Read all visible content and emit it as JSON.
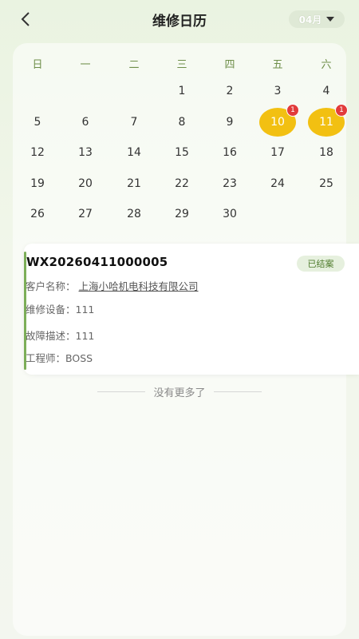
{
  "header": {
    "title": "维修日历",
    "back_icon": "chevron-left-icon",
    "month": "04月",
    "month_caret_icon": "caret-down-icon"
  },
  "calendar": {
    "weekdays": [
      "日",
      "一",
      "二",
      "三",
      "四",
      "五",
      "六"
    ],
    "days": [
      {
        "d": "1"
      },
      {
        "d": "2"
      },
      {
        "d": "3"
      },
      {
        "d": "4"
      },
      {
        "d": "5"
      },
      {
        "d": "6"
      },
      {
        "d": "7"
      },
      {
        "d": "8"
      },
      {
        "d": "9"
      },
      {
        "d": "10",
        "badge": "1"
      },
      {
        "d": "11",
        "badge": "1"
      },
      {
        "d": "12"
      },
      {
        "d": "13"
      },
      {
        "d": "14"
      },
      {
        "d": "15"
      },
      {
        "d": "16"
      },
      {
        "d": "17"
      },
      {
        "d": "18"
      },
      {
        "d": "19"
      },
      {
        "d": "20"
      },
      {
        "d": "21"
      },
      {
        "d": "22"
      },
      {
        "d": "23"
      },
      {
        "d": "24"
      },
      {
        "d": "25"
      },
      {
        "d": "26"
      },
      {
        "d": "27"
      },
      {
        "d": "28"
      },
      {
        "d": "29"
      },
      {
        "d": "30"
      }
    ],
    "marked_color": "#f2c012",
    "badge_color": "#e23b3b"
  },
  "order": {
    "order_no": "WX20260411000005",
    "status": "已结案",
    "customer_label": "客户名称：",
    "customer_value": "上海小哈机电科技有限公司",
    "device_label": "维修设备：",
    "device_value": "111",
    "fault_label": "故障描述：",
    "fault_value": "111",
    "engineer_label": "工程师：",
    "engineer_value": "BOSS",
    "accent_color": "#7cae58"
  },
  "footer": {
    "no_more": "没有更多了"
  }
}
